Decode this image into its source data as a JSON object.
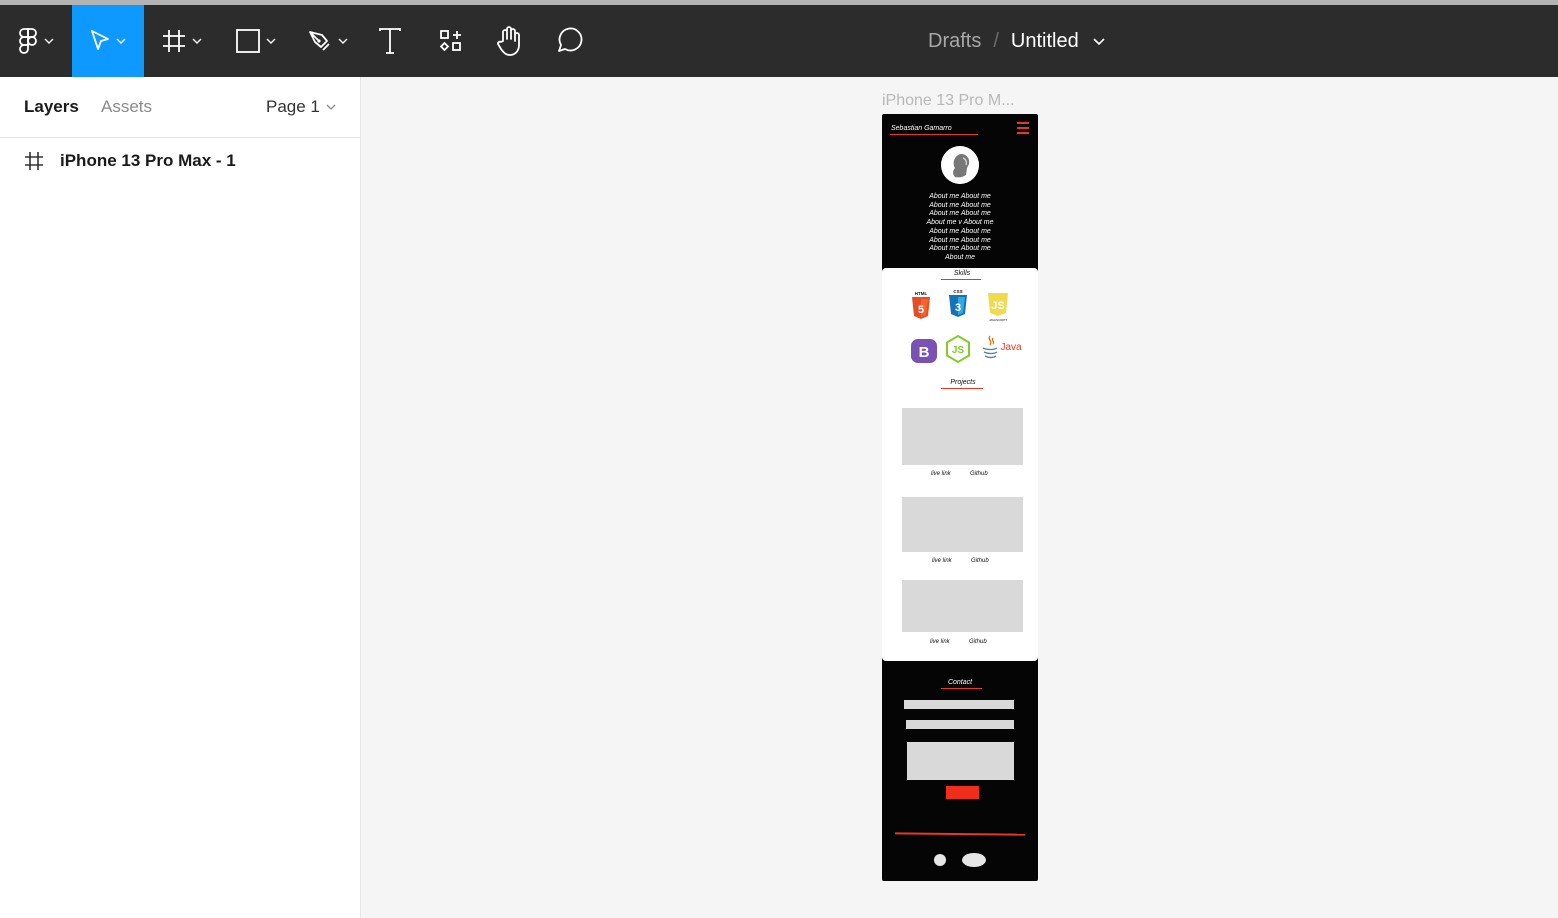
{
  "toolbar": {
    "tools": [
      {
        "name": "main-menu",
        "icon": "figma-logo-icon",
        "has_dropdown": true
      },
      {
        "name": "move-tool",
        "icon": "cursor-arrow-icon",
        "has_dropdown": true,
        "active": true
      },
      {
        "name": "frame-tool",
        "icon": "frame-hash-icon",
        "has_dropdown": true
      },
      {
        "name": "shape-tool",
        "icon": "rectangle-icon",
        "has_dropdown": true
      },
      {
        "name": "pen-tool",
        "icon": "pen-nib-icon",
        "has_dropdown": true
      },
      {
        "name": "text-tool",
        "icon": "text-t-icon",
        "has_dropdown": false
      },
      {
        "name": "resources-tool",
        "icon": "components-grid-icon",
        "has_dropdown": false
      },
      {
        "name": "hand-tool",
        "icon": "hand-icon",
        "has_dropdown": false
      },
      {
        "name": "comment-tool",
        "icon": "comment-bubble-icon",
        "has_dropdown": false
      }
    ],
    "breadcrumb": {
      "folder": "Drafts",
      "separator": "/",
      "file": "Untitled"
    },
    "colors": {
      "bar": "#2c2c2c",
      "active": "#0d99ff"
    }
  },
  "left_panel": {
    "tabs": {
      "layers": "Layers",
      "assets": "Assets"
    },
    "page_selector": "Page 1",
    "layers": [
      {
        "name": "iPhone 13 Pro Max - 1",
        "icon": "frame-hash-icon"
      }
    ]
  },
  "canvas": {
    "frame_label": "iPhone 13 Pro M...",
    "phone": {
      "header_name": "Sebastian Gamarro",
      "about_lines": [
        "About me About me",
        "About me About me",
        "About me About me",
        "About me v About me",
        "About me About me",
        "About me About me",
        "About me About me",
        "About me"
      ],
      "skills_title": "Skills",
      "skills": [
        {
          "label": "HTML",
          "badge": "5",
          "color": "#e44d26"
        },
        {
          "label": "CSS",
          "badge": "3",
          "color": "#1572b6"
        },
        {
          "label": "JAVASCRIPT",
          "badge": "JS",
          "color": "#f0db4f"
        },
        {
          "label": "",
          "badge": "B",
          "color": "#7952b3"
        },
        {
          "label": "",
          "badge": "JS",
          "color": "#83cd29"
        },
        {
          "label": "Java",
          "badge": "",
          "color": "#e76f00"
        }
      ],
      "projects_title": "Projects",
      "projects": [
        {
          "live": "live link",
          "repo": "Github"
        },
        {
          "live": "live link",
          "repo": "Github"
        },
        {
          "live": "live link",
          "repo": "Github"
        }
      ],
      "contact_title": "Contact",
      "accent": "#e8381f"
    }
  }
}
